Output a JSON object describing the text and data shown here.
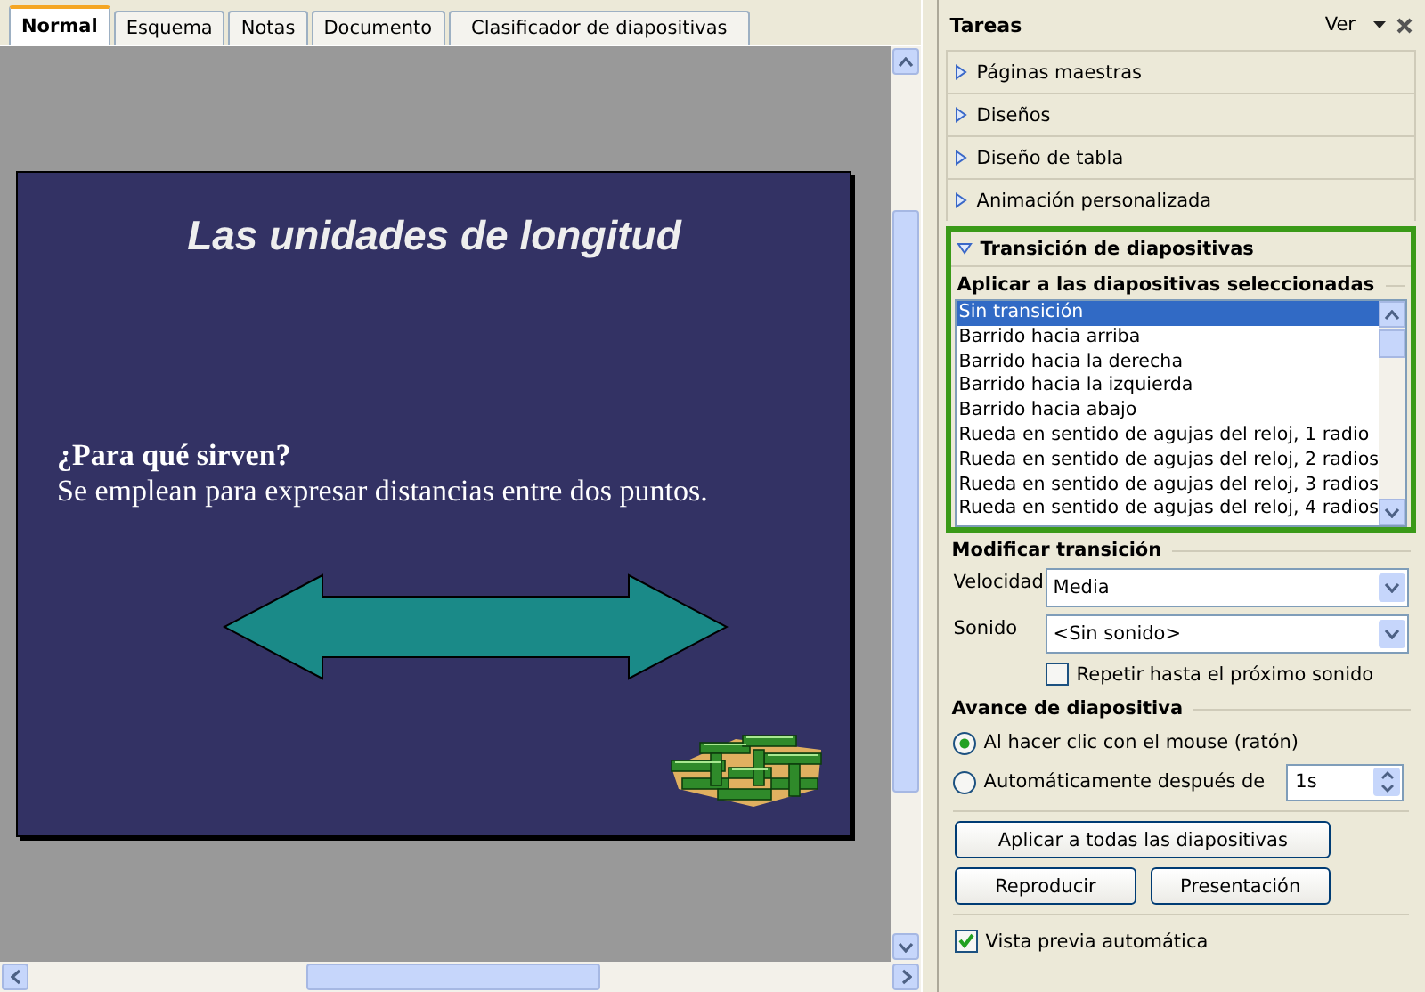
{
  "tabs": [
    {
      "label": "Normal",
      "selected": true
    },
    {
      "label": "Esquema",
      "selected": false
    },
    {
      "label": "Notas",
      "selected": false
    },
    {
      "label": "Documento",
      "selected": false
    },
    {
      "label": "Clasificador de diapositivas",
      "selected": false
    }
  ],
  "slide": {
    "title": "Las unidades de longitud",
    "question": "¿Para qué sirven?",
    "body": "Se emplean para expresar distancias entre dos puntos."
  },
  "task_pane": {
    "title": "Tareas",
    "view_menu": "Ver",
    "sections": [
      {
        "label": "Páginas maestras",
        "expanded": false
      },
      {
        "label": "Diseños",
        "expanded": false
      },
      {
        "label": "Diseño de tabla",
        "expanded": false
      },
      {
        "label": "Animación personalizada",
        "expanded": false
      },
      {
        "label": "Transición de diapositivas",
        "expanded": true
      }
    ],
    "apply_heading": "Aplicar a las diapositivas seleccionadas",
    "transitions": [
      {
        "label": "Sin transición",
        "selected": true
      },
      {
        "label": "Barrido hacia arriba",
        "selected": false
      },
      {
        "label": "Barrido hacia la derecha",
        "selected": false
      },
      {
        "label": "Barrido hacia la izquierda",
        "selected": false
      },
      {
        "label": "Barrido hacia abajo",
        "selected": false
      },
      {
        "label": "Rueda en sentido de agujas del reloj, 1 radio",
        "selected": false
      },
      {
        "label": "Rueda en sentido de agujas del reloj, 2 radios",
        "selected": false
      },
      {
        "label": "Rueda en sentido de agujas del reloj, 3 radios",
        "selected": false
      },
      {
        "label": "Rueda en sentido de agujas del reloj, 4 radios",
        "selected": false
      }
    ],
    "modify_heading": "Modificar transición",
    "speed": {
      "label": "Velocidad",
      "value": "Media"
    },
    "sound": {
      "label": "Sonido",
      "value": "<Sin sonido>"
    },
    "repeat_sound": {
      "label": "Repetir hasta el próximo sonido",
      "checked": false
    },
    "advance_heading": "Avance de diapositiva",
    "advance_options": [
      {
        "label": "Al hacer clic con el mouse (ratón)",
        "selected": true
      },
      {
        "label": "Automáticamente después de",
        "selected": false
      }
    ],
    "auto_delay": "1s",
    "apply_all_button": "Aplicar a todas las diapositivas",
    "buttons": [
      "Reproducir",
      "Presentación"
    ],
    "auto_preview": {
      "label": "Vista previa automática",
      "checked": true
    }
  }
}
